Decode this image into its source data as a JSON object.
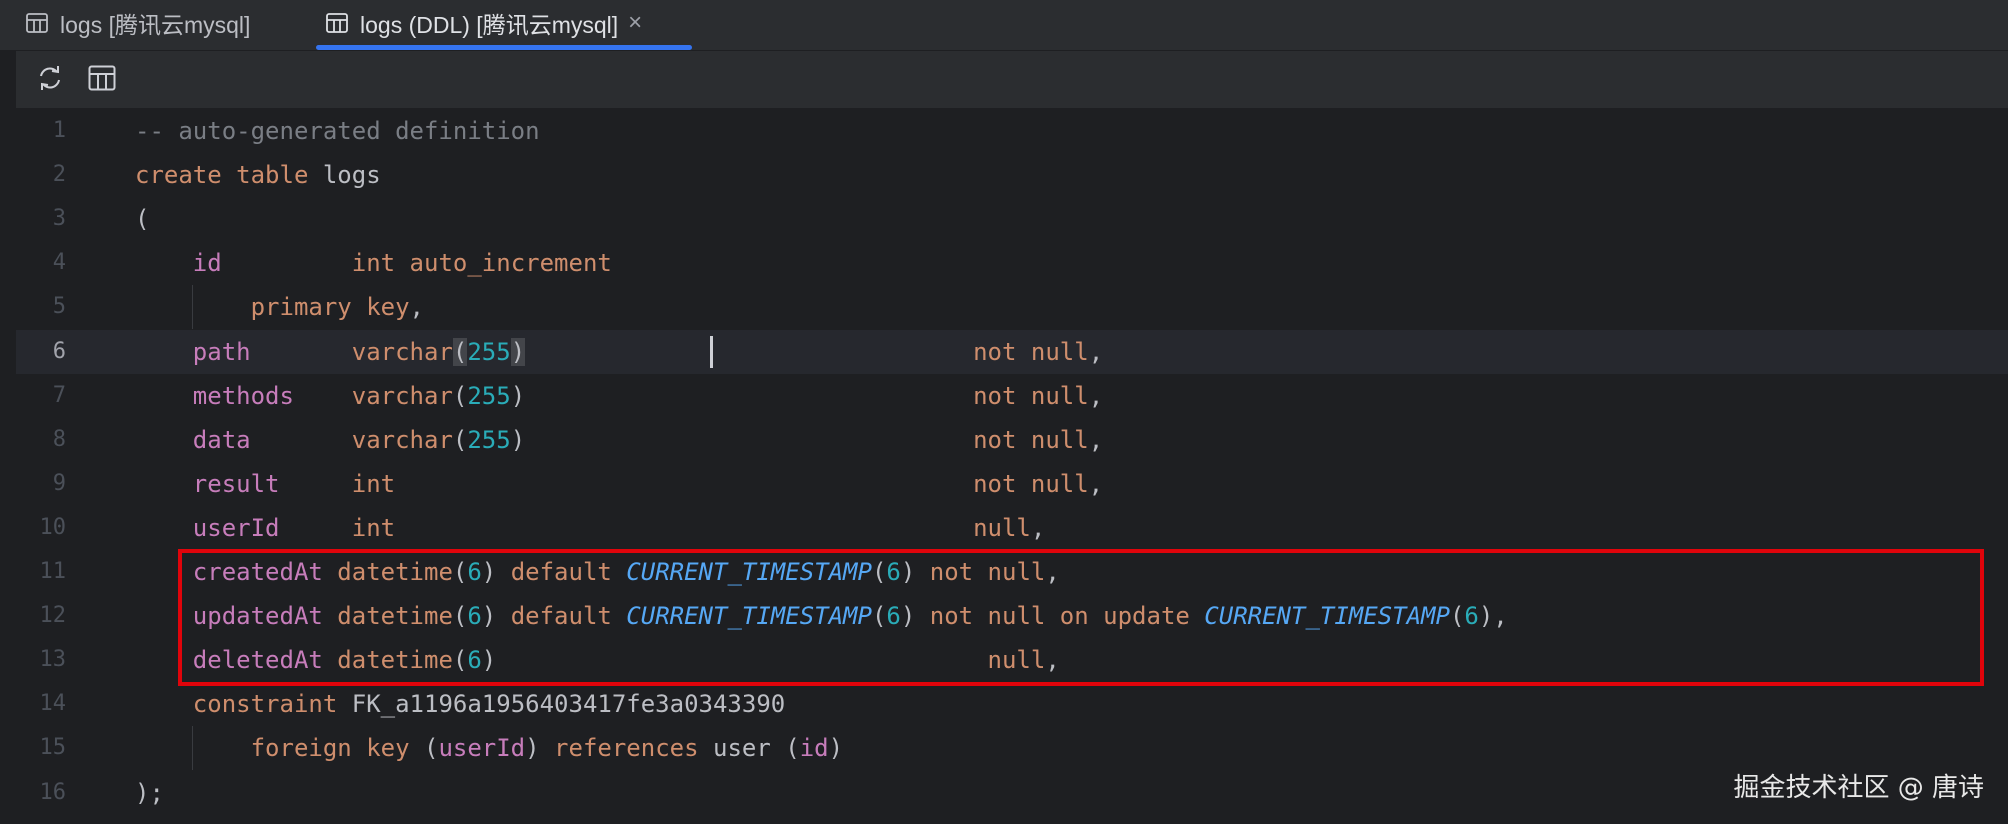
{
  "tabs": [
    {
      "label": "logs [腾讯云mysql]",
      "active": false
    },
    {
      "label": "logs (DDL) [腾讯云mysql]",
      "active": true,
      "close": "×"
    }
  ],
  "toolbar": {
    "refresh_icon": "refresh-icon",
    "table_icon": "table-icon"
  },
  "editor": {
    "current_line": 6,
    "line_numbers": [
      "1",
      "2",
      "3",
      "4",
      "5",
      "6",
      "7",
      "8",
      "9",
      "10",
      "11",
      "12",
      "13",
      "14",
      "15",
      "16"
    ],
    "lines": [
      [
        {
          "t": "-- auto-generated definition",
          "c": "cmt"
        }
      ],
      [
        {
          "t": "create table ",
          "c": "kw"
        },
        {
          "t": "logs",
          "c": "plain"
        }
      ],
      [
        {
          "t": "(",
          "c": "plain"
        }
      ],
      [
        {
          "t": "    ",
          "c": "plain"
        },
        {
          "t": "id",
          "c": "fld"
        },
        {
          "t": "         ",
          "c": "plain"
        },
        {
          "t": "int auto_increment",
          "c": "kw"
        }
      ],
      [
        {
          "t": "        ",
          "c": "plain"
        },
        {
          "t": "primary key",
          "c": "kw"
        },
        {
          "t": ",",
          "c": "plain"
        }
      ],
      [
        {
          "t": "    ",
          "c": "plain"
        },
        {
          "t": "path",
          "c": "fld"
        },
        {
          "t": "       ",
          "c": "plain"
        },
        {
          "t": "varchar",
          "c": "kw"
        },
        {
          "t": "(",
          "c": "plain paren-hl"
        },
        {
          "t": "255",
          "c": "num"
        },
        {
          "t": ")",
          "c": "plain paren-hl"
        },
        {
          "t": "                               ",
          "c": "plain"
        },
        {
          "t": "not null",
          "c": "kw"
        },
        {
          "t": ",",
          "c": "plain"
        }
      ],
      [
        {
          "t": "    ",
          "c": "plain"
        },
        {
          "t": "methods",
          "c": "fld"
        },
        {
          "t": "    ",
          "c": "plain"
        },
        {
          "t": "varchar",
          "c": "kw"
        },
        {
          "t": "(",
          "c": "plain"
        },
        {
          "t": "255",
          "c": "num"
        },
        {
          "t": ")",
          "c": "plain"
        },
        {
          "t": "                               ",
          "c": "plain"
        },
        {
          "t": "not null",
          "c": "kw"
        },
        {
          "t": ",",
          "c": "plain"
        }
      ],
      [
        {
          "t": "    ",
          "c": "plain"
        },
        {
          "t": "data",
          "c": "fld"
        },
        {
          "t": "       ",
          "c": "plain"
        },
        {
          "t": "varchar",
          "c": "kw"
        },
        {
          "t": "(",
          "c": "plain"
        },
        {
          "t": "255",
          "c": "num"
        },
        {
          "t": ")",
          "c": "plain"
        },
        {
          "t": "                               ",
          "c": "plain"
        },
        {
          "t": "not null",
          "c": "kw"
        },
        {
          "t": ",",
          "c": "plain"
        }
      ],
      [
        {
          "t": "    ",
          "c": "plain"
        },
        {
          "t": "result",
          "c": "fld"
        },
        {
          "t": "     ",
          "c": "plain"
        },
        {
          "t": "int",
          "c": "kw"
        },
        {
          "t": "                                        ",
          "c": "plain"
        },
        {
          "t": "not null",
          "c": "kw"
        },
        {
          "t": ",",
          "c": "plain"
        }
      ],
      [
        {
          "t": "    ",
          "c": "plain"
        },
        {
          "t": "userId",
          "c": "fld"
        },
        {
          "t": "     ",
          "c": "plain"
        },
        {
          "t": "int",
          "c": "kw"
        },
        {
          "t": "                                        ",
          "c": "plain"
        },
        {
          "t": "null",
          "c": "kw"
        },
        {
          "t": ",",
          "c": "plain"
        }
      ],
      [
        {
          "t": "    ",
          "c": "plain"
        },
        {
          "t": "createdAt",
          "c": "fld"
        },
        {
          "t": " ",
          "c": "plain"
        },
        {
          "t": "datetime",
          "c": "kw"
        },
        {
          "t": "(",
          "c": "plain"
        },
        {
          "t": "6",
          "c": "num"
        },
        {
          "t": ") ",
          "c": "plain"
        },
        {
          "t": "default ",
          "c": "kw"
        },
        {
          "t": "CURRENT_TIMESTAMP",
          "c": "fn"
        },
        {
          "t": "(",
          "c": "plain"
        },
        {
          "t": "6",
          "c": "num"
        },
        {
          "t": ") ",
          "c": "plain"
        },
        {
          "t": "not null",
          "c": "kw"
        },
        {
          "t": ",",
          "c": "plain"
        }
      ],
      [
        {
          "t": "    ",
          "c": "plain"
        },
        {
          "t": "updatedAt",
          "c": "fld"
        },
        {
          "t": " ",
          "c": "plain"
        },
        {
          "t": "datetime",
          "c": "kw"
        },
        {
          "t": "(",
          "c": "plain"
        },
        {
          "t": "6",
          "c": "num"
        },
        {
          "t": ") ",
          "c": "plain"
        },
        {
          "t": "default ",
          "c": "kw"
        },
        {
          "t": "CURRENT_TIMESTAMP",
          "c": "fn"
        },
        {
          "t": "(",
          "c": "plain"
        },
        {
          "t": "6",
          "c": "num"
        },
        {
          "t": ") ",
          "c": "plain"
        },
        {
          "t": "not null on update ",
          "c": "kw"
        },
        {
          "t": "CURRENT_TIMESTAMP",
          "c": "fn"
        },
        {
          "t": "(",
          "c": "plain"
        },
        {
          "t": "6",
          "c": "num"
        },
        {
          "t": "),",
          "c": "plain"
        }
      ],
      [
        {
          "t": "    ",
          "c": "plain"
        },
        {
          "t": "deletedAt",
          "c": "fld"
        },
        {
          "t": " ",
          "c": "plain"
        },
        {
          "t": "datetime",
          "c": "kw"
        },
        {
          "t": "(",
          "c": "plain"
        },
        {
          "t": "6",
          "c": "num"
        },
        {
          "t": ")",
          "c": "plain"
        },
        {
          "t": "                                  ",
          "c": "plain"
        },
        {
          "t": "null",
          "c": "kw"
        },
        {
          "t": ",",
          "c": "plain"
        }
      ],
      [
        {
          "t": "    ",
          "c": "plain"
        },
        {
          "t": "constraint ",
          "c": "kw"
        },
        {
          "t": "FK_a1196a1956403417fe3a0343390",
          "c": "plain"
        }
      ],
      [
        {
          "t": "        ",
          "c": "plain"
        },
        {
          "t": "foreign key ",
          "c": "kw"
        },
        {
          "t": "(",
          "c": "plain"
        },
        {
          "t": "userId",
          "c": "fld"
        },
        {
          "t": ") ",
          "c": "plain"
        },
        {
          "t": "references ",
          "c": "kw"
        },
        {
          "t": "user ",
          "c": "plain"
        },
        {
          "t": "(",
          "c": "plain"
        },
        {
          "t": "id",
          "c": "fld"
        },
        {
          "t": ")",
          "c": "plain"
        }
      ],
      [
        {
          "t": ");",
          "c": "plain"
        }
      ]
    ]
  },
  "watermark": "掘金技术社区 @ 唐诗",
  "colors": {
    "keyword": "#cf8e6d",
    "field": "#c77dbb",
    "number": "#2aacb8",
    "comment": "#7a7e85",
    "function": "#56a8f5",
    "highlight_border": "#e0040b",
    "tab_underline": "#3574f0"
  }
}
